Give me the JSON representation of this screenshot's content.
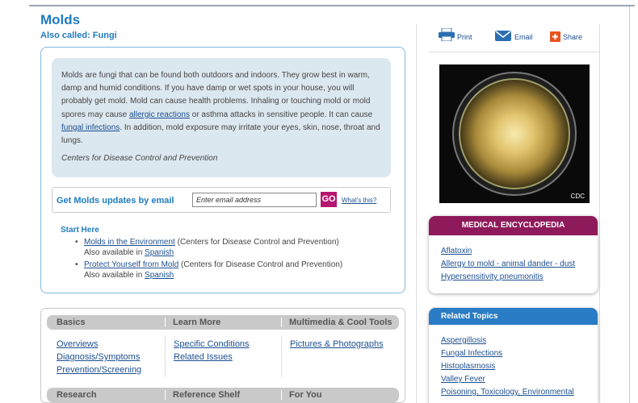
{
  "page": {
    "title": "Molds",
    "also_called": "Also called: Fungi"
  },
  "summary": {
    "part1": "Molds are fungi that can be found both outdoors and indoors. They grow best in warm, damp and humid conditions. If you have damp or wet spots in your house, you will probably get mold. Mold can cause health problems. Inhaling or touching mold or mold spores may cause ",
    "link1": "allergic reactions",
    "part2": " or asthma attacks in sensitive people. It can cause ",
    "link2": "fungal infections",
    "part3": ". In addition, mold exposure may irritate your eyes, skin, nose, throat and lungs.",
    "source": "Centers for Disease Control and Prevention"
  },
  "email": {
    "label": "Get Molds updates by email",
    "placeholder": "Enter email address",
    "go": "GO",
    "whats_this": "What's this?"
  },
  "start_here": {
    "heading": "Start Here",
    "items": [
      {
        "link": "Molds in the Environment",
        "source": " (Centers for Disease Control and Prevention)",
        "also": "Also available in ",
        "lang": "Spanish"
      },
      {
        "link": "Protect Yourself from Mold",
        "source": " (Centers for Disease Control and Prevention)",
        "also": "Also available in ",
        "lang": "Spanish"
      }
    ]
  },
  "tools_table": {
    "row1_headers": [
      "Basics",
      "Learn More",
      "Multimedia & Cool Tools"
    ],
    "row2_headers": [
      "Research",
      "Reference Shelf",
      "For You"
    ],
    "basics": [
      "Overviews",
      "Diagnosis/Symptoms",
      "Prevention/Screening"
    ],
    "learn_more": [
      "Specific Conditions",
      "Related Issues"
    ],
    "multimedia": [
      "Pictures & Photographs"
    ]
  },
  "share": {
    "print": "Print",
    "email": "Email",
    "share": "Share",
    "colors": {
      "print": "#2b6fb1",
      "email": "#2b6fb1",
      "share": "#e8531e"
    }
  },
  "image": {
    "credit": "CDC"
  },
  "encyclopedia": {
    "heading": "MEDICAL ENCYCLOPEDIA",
    "items": [
      "Aflatoxin",
      "Allergy to mold - animal dander - dust",
      "Hypersensitivity pneumonitis"
    ]
  },
  "related": {
    "heading": "Related Topics",
    "items": [
      "Aspergillosis",
      "Fungal Infections",
      "Histoplasmosis",
      "Valley Fever",
      "Poisoning, Toxicology, Environmental"
    ]
  },
  "colors": {
    "title_blue": "#1f7cbf",
    "link": "#1d4f91",
    "encyclopedia_header": "#8e1a5b",
    "related_header": "#2a7cc4",
    "go_button": "#b5156e",
    "summary_bg": "#dce8f0"
  }
}
